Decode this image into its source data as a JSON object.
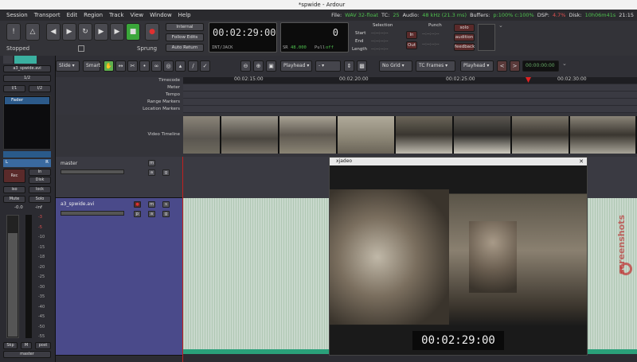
{
  "window": {
    "title": "*spwide - Ardour"
  },
  "menu": [
    "Session",
    "Transport",
    "Edit",
    "Region",
    "Track",
    "View",
    "Window",
    "Help"
  ],
  "status": {
    "file_label": "File:",
    "file_value": "WAV 32-float",
    "tc_label": "TC:",
    "tc_value": "25",
    "audio_label": "Audio:",
    "audio_value": "48 kHz (21.3 ms)",
    "buffers_label": "Buffers:",
    "buffers_value": "p:100% c:100%",
    "dsp_label": "DSP:",
    "dsp_value": "4.7%",
    "disk_label": "Disk:",
    "disk_value": "10h06m41s",
    "time": "21:15"
  },
  "transport": {
    "state": "Stopped",
    "sprung": "Sprung",
    "internal": "Internal",
    "follow_edits": "Follow Edits",
    "auto_return": "Auto Return",
    "primary_clock": "00:02:29:00",
    "clock_source": "INT/JACK",
    "secondary_clock": "0",
    "sr_label": "SR",
    "sr_value": "48.000",
    "pull_label": "Pull",
    "pull_value": "off",
    "selection_label": "Selection",
    "punch_label": "Punch",
    "start_label": "Start",
    "end_label": "End",
    "length_label": "Length",
    "sel_start": "--:--:--:--",
    "sel_end": "--:--:--:--",
    "sel_length": "--:--:--:--",
    "punch_in": "In",
    "punch_out": "Out",
    "punch_in_time": "--:--:--:--",
    "punch_out_time": "--:--:--:--",
    "solo": "solo",
    "audition": "audition",
    "feedback": "feedback"
  },
  "toolbar": {
    "edit_mode": "Slide",
    "smart": "Smart",
    "edit_point": "Playhead",
    "grid": "No Grid",
    "grid_units": "TC Frames",
    "nudge_point": "Playhead",
    "nudge_clock": "00:00:00:00"
  },
  "strip": {
    "name": "a3_spwide.avi",
    "input": "1/2",
    "in1": "I/1",
    "in2": "I/2",
    "plugin": "Fader",
    "pan_l": "L",
    "pan_r": "R",
    "rec": "Rec",
    "in": "In",
    "disk": "Disk",
    "iso": "iso",
    "lock": "lock",
    "mute": "Mute",
    "solo": "Solo",
    "gain": "-0.0",
    "peak": "-inf",
    "skip": "Skp",
    "m": "M",
    "post": "post",
    "comments": "master"
  },
  "meter_scale": [
    "-3",
    "-5",
    "-10",
    "-15",
    "-18",
    "-20",
    "-25",
    "-30",
    "-35",
    "-40",
    "-45",
    "-50",
    "-55"
  ],
  "rulers": {
    "labels": [
      "Timecode",
      "Meter",
      "Tempo",
      "Range Markers",
      "Location Markers"
    ],
    "ticks": [
      "00:02:15:00",
      "00:02:20:00",
      "00:02:25:00",
      "00:02:30:00"
    ],
    "video_label": "Video Timeline"
  },
  "tracks": {
    "master": {
      "name": "master",
      "m": "m",
      "a": "a",
      "g": "g"
    },
    "audio": {
      "name": "a3_spwide.avi",
      "m": "m",
      "s": "s",
      "p": "p",
      "a": "a",
      "g": "g"
    }
  },
  "video_window": {
    "title": "xjadeo",
    "timecode": "00:02:29:00"
  },
  "watermark": "screenshots"
}
